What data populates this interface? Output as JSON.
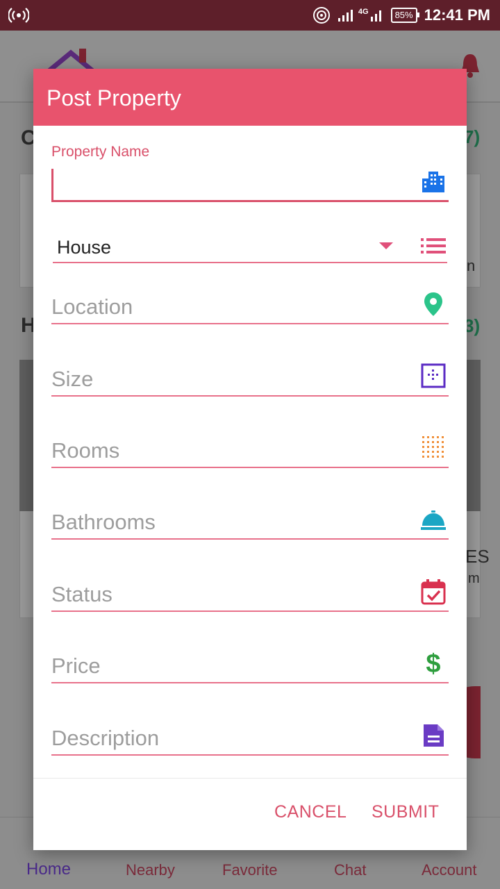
{
  "status_bar": {
    "time": "12:41 PM",
    "battery": "85%",
    "network": "4G"
  },
  "background": {
    "fragments": [
      "C",
      "7)",
      "H",
      "3)",
      "n",
      "ES",
      "m"
    ],
    "nav": [
      "Home",
      "Nearby",
      "Favorite",
      "Chat",
      "Account"
    ]
  },
  "dialog": {
    "title": "Post Property",
    "property_name": {
      "label": "Property Name",
      "value": ""
    },
    "type": {
      "selected": "House"
    },
    "location": {
      "placeholder": "Location"
    },
    "size": {
      "placeholder": "Size"
    },
    "rooms": {
      "placeholder": "Rooms"
    },
    "bathrooms": {
      "placeholder": "Bathrooms"
    },
    "status": {
      "placeholder": "Status"
    },
    "price": {
      "placeholder": "Price"
    },
    "description": {
      "placeholder": "Description"
    },
    "cancel_label": "CANCEL",
    "submit_label": "SUBMIT"
  },
  "icon_colors": {
    "building": "#1a73e8",
    "list": "#e0507a",
    "location": "#2bc48a",
    "size": "#5b2bc4",
    "rooms": "#f0903a",
    "bathrooms": "#1ba6c4",
    "status": "#d9314f",
    "price": "#2e9e3e",
    "description": "#6a3bc4"
  }
}
